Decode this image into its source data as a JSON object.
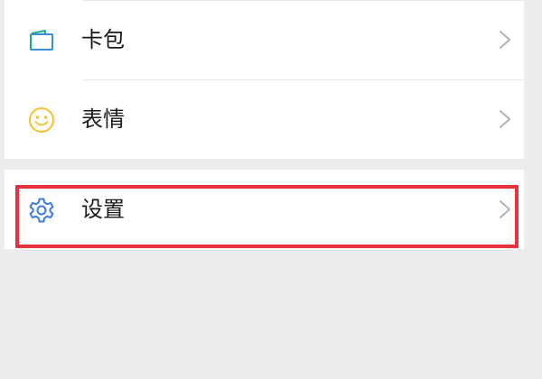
{
  "menu": {
    "items": [
      {
        "label": "卡包",
        "icon": "wallet-icon",
        "accent": "#1aad8c"
      },
      {
        "label": "表情",
        "icon": "smiley-icon",
        "accent": "#f5c32c"
      },
      {
        "label": "设置",
        "icon": "gear-icon",
        "accent": "#3b7dde"
      }
    ]
  },
  "highlight": {
    "color": "#e8323c",
    "target": "settings"
  },
  "colors": {
    "background": "#ededed",
    "card": "#ffffff",
    "text": "#181818",
    "chevron": "#b2b2b2",
    "divider": "#e6e6e6"
  }
}
